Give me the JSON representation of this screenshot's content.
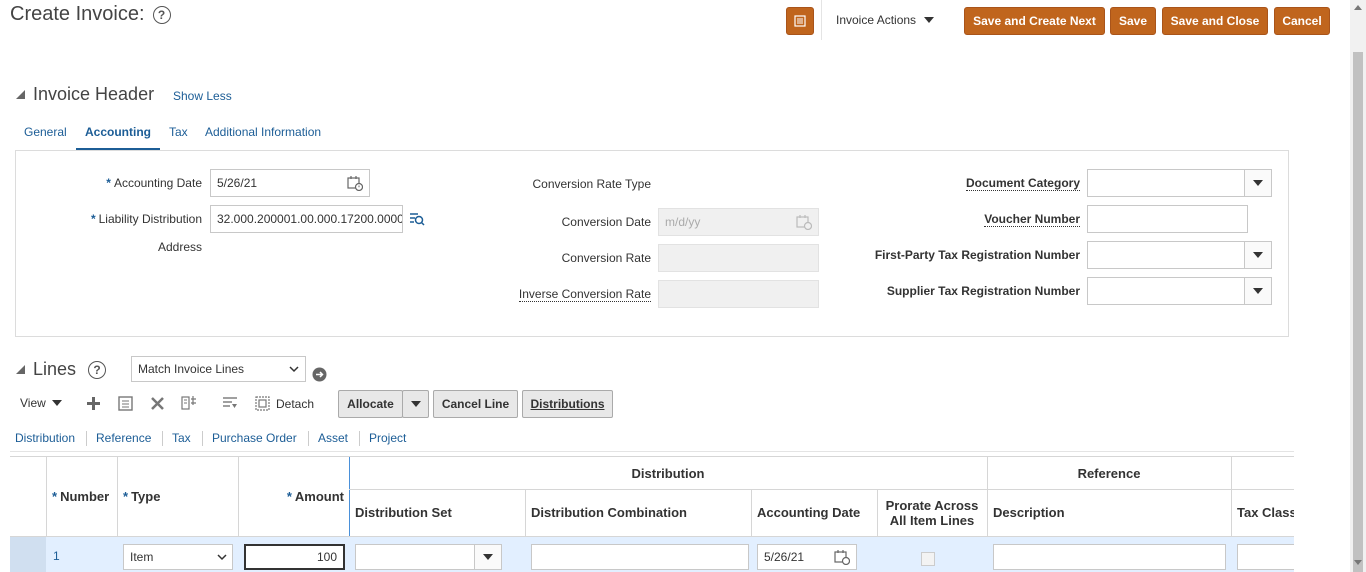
{
  "header": {
    "title": "Create Invoice:",
    "help_glyph": "?",
    "invoice_actions_label": "Invoice Actions",
    "buttons": {
      "save_create_next": "Save and Create Next",
      "save": "Save",
      "save_close": "Save and Close",
      "cancel": "Cancel"
    },
    "accent_color": "#c0651d"
  },
  "invoice_header": {
    "title": "Invoice Header",
    "show_less": "Show Less",
    "tabs": [
      "General",
      "Accounting",
      "Tax",
      "Additional Information"
    ],
    "active_tab": "Accounting",
    "fields": {
      "accounting_date_label": "Accounting Date",
      "accounting_date_value": "5/26/21",
      "liability_distribution_label": "Liability Distribution",
      "liability_distribution_value": "32.000.200001.00.000.17200.0000",
      "address_label": "Address",
      "conversion_rate_type_label": "Conversion Rate Type",
      "conversion_date_label": "Conversion Date",
      "conversion_date_placeholder": "m/d/yy",
      "conversion_rate_label": "Conversion Rate",
      "inverse_conversion_rate_label": "Inverse Conversion Rate",
      "document_category_label": "Document Category",
      "voucher_number_label": "Voucher Number",
      "first_party_tax_label": "First-Party Tax Registration Number",
      "supplier_tax_label": "Supplier Tax Registration Number"
    }
  },
  "lines": {
    "title": "Lines",
    "match_select": "Match Invoice Lines",
    "toolbar": {
      "view": "View",
      "detach": "Detach",
      "allocate": "Allocate",
      "cancel_line": "Cancel Line",
      "distributions": "Distributions"
    },
    "subtabs": [
      "Distribution",
      "Reference",
      "Tax",
      "Purchase Order",
      "Asset",
      "Project"
    ],
    "columns": {
      "number": "Number",
      "type": "Type",
      "amount": "Amount",
      "distribution_group": "Distribution",
      "distribution_set": "Distribution Set",
      "distribution_combination": "Distribution Combination",
      "accounting_date": "Accounting Date",
      "prorate_line1": "Prorate Across",
      "prorate_line2": "All Item Lines",
      "reference_group": "Reference",
      "description": "Description",
      "tax_class": "Tax Class"
    },
    "rows": [
      {
        "number": "1",
        "type": "Item",
        "amount": "100",
        "accounting_date": "5/26/21"
      }
    ]
  }
}
